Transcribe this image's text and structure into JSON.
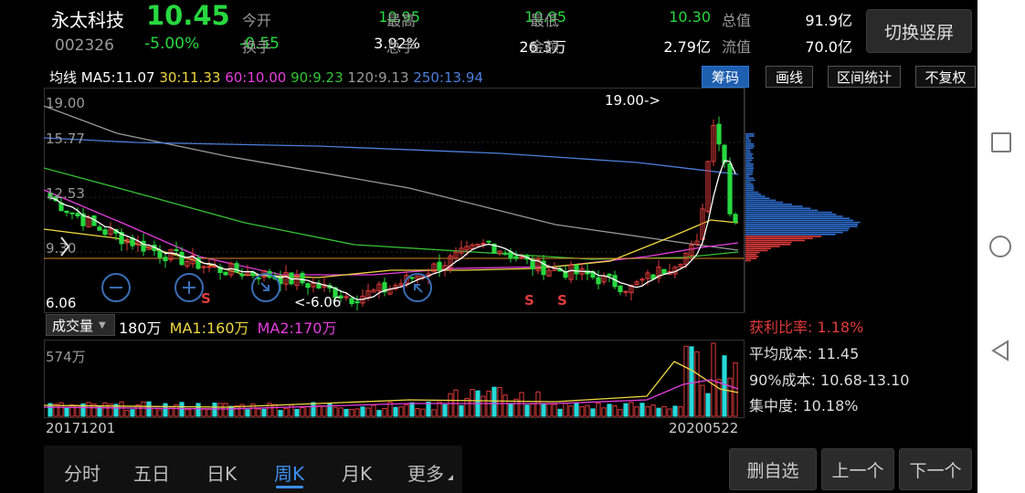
{
  "stock": {
    "name": "永太科技",
    "code": "002326",
    "price": "10.45",
    "change_pct": "-5.00%",
    "change": "-0.55"
  },
  "quote": [
    {
      "label": "今开",
      "value": "10.95",
      "color": "green"
    },
    {
      "label": "最高",
      "value": "10.95",
      "color": "green"
    },
    {
      "label": "最低",
      "value": "10.30",
      "color": "green"
    },
    {
      "label": "总值",
      "value": "91.9亿",
      "color": "white"
    },
    {
      "label": "换手",
      "value": "3.92%",
      "color": "white"
    },
    {
      "label": "总手",
      "value": "26.3万",
      "color": "white"
    },
    {
      "label": "金额",
      "value": "2.79亿",
      "color": "white"
    },
    {
      "label": "流值",
      "value": "70.0亿",
      "color": "white"
    }
  ],
  "rotate_button": "切换竖屏",
  "ma": {
    "title": "均线",
    "ma5": "MA5:11.07",
    "ma30": "30:11.33",
    "ma60": "60:10.00",
    "ma90": "90:9.23",
    "ma120": "120:9.13",
    "ma250": "250:13.94"
  },
  "tools": [
    "筹码",
    "画线",
    "区间统计",
    "不复权"
  ],
  "price_axis": {
    "top": "19.00",
    "l2": "15.77",
    "l3": "12.53",
    "l4": "9.30",
    "bottom": "6.06"
  },
  "markers": {
    "high": "19.00->",
    "low": "<-6.06",
    "signal": "S"
  },
  "volume": {
    "selector": "成交量",
    "value": "180万",
    "ma1": "MA1:160万",
    "ma2": "MA2:170万",
    "axis_max": "574万"
  },
  "chip": {
    "profit": "获利比率: 1.18%",
    "avg_cost": "平均成本: 11.45",
    "cost90": "90%成本: 10.68-13.10",
    "concentration": "集中度: 10.18%"
  },
  "dates": {
    "start": "20171201",
    "end": "20200522"
  },
  "tabs": [
    "分时",
    "五日",
    "日K",
    "周K",
    "月K",
    "更多"
  ],
  "active_tab": "周K",
  "bottom_buttons": [
    "删自选",
    "上一个",
    "下一个"
  ],
  "colors": {
    "up": "#e23b3b",
    "down": "#27d83f",
    "ma5": "#ffffff",
    "ma30": "#f0d840",
    "ma60": "#e83ee0",
    "ma90": "#35c235",
    "ma120": "#9a9a9a",
    "ma250": "#4e7fdc",
    "accent": "#3d8ef0"
  }
}
